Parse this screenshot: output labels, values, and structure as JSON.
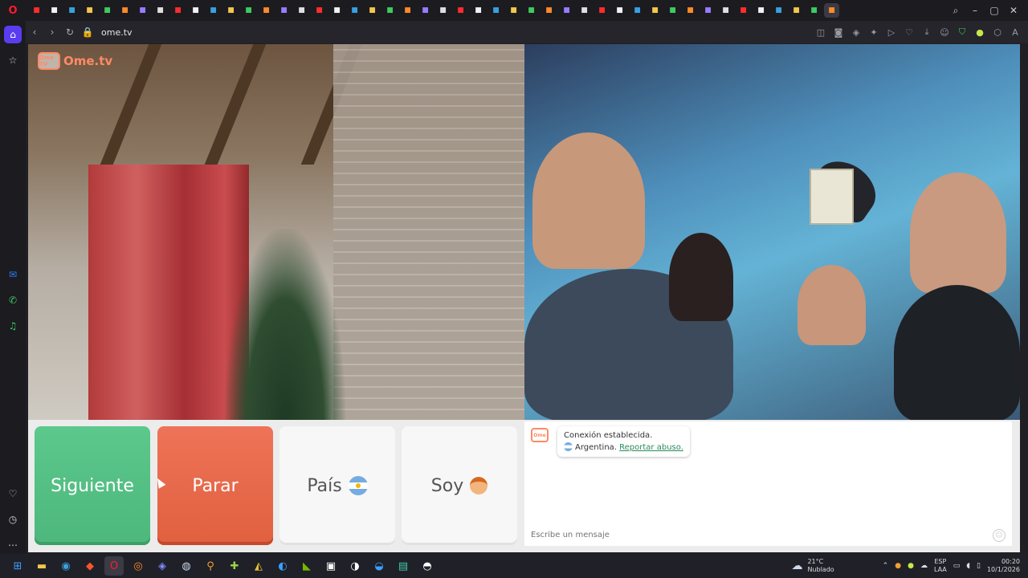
{
  "browser": {
    "url": "ome.tv",
    "tab_count": 46
  },
  "site": {
    "logo_text": "Ome.tv",
    "logo_mark_text": "Ome TV"
  },
  "buttons": {
    "next": "Siguiente",
    "stop": "Parar",
    "country": "País",
    "gender": "Soy"
  },
  "chat": {
    "status": "Conexión establecida.",
    "country": "Argentina.",
    "report": "Reportar abuso.",
    "placeholder": "Escribe un mensaje"
  },
  "taskbar": {
    "temperature": "21°C",
    "weather": "Nublado",
    "lang_top": "ESP",
    "lang_bottom": "LAA",
    "time": "00:20",
    "date": "10/1/2026"
  },
  "colors": {
    "next_green": "#5cc88c",
    "stop_red": "#ef7358",
    "ome_orange": "#ff8a65",
    "opera_red": "#ff1b2d"
  }
}
